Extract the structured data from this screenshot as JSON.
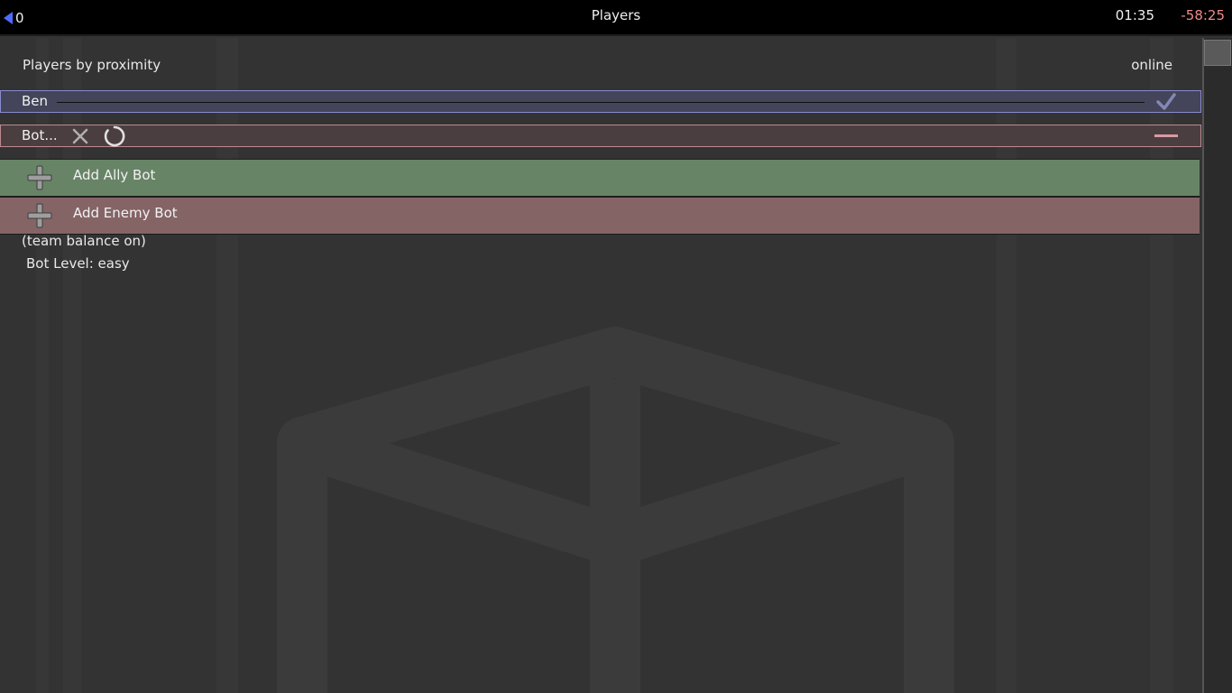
{
  "topbar": {
    "back_count": "0",
    "title": "Players",
    "clock": "01:35",
    "timer": "-58:25"
  },
  "list": {
    "section_title": "Players by proximity",
    "status": "online"
  },
  "players": [
    {
      "name": "Ben",
      "team": "ally"
    },
    {
      "name": "Bot...",
      "team": "enemy"
    }
  ],
  "actions": {
    "add_ally": "Add Ally Bot",
    "add_enemy": "Add Enemy Bot"
  },
  "settings": {
    "balance": "(team balance on)",
    "bot_level": "Bot Level: easy"
  },
  "colors": {
    "ally_row": "#44445a",
    "enemy_row": "#4b3e40",
    "ally_button": "#678466",
    "enemy_button": "#856466",
    "timer": "#f08a8a",
    "back_arrow": "#4f6bff"
  },
  "icons": [
    "back-arrow-icon",
    "check-icon",
    "kick-x-icon",
    "loading-spinner-icon",
    "remove-minus-icon",
    "plus-icon"
  ]
}
